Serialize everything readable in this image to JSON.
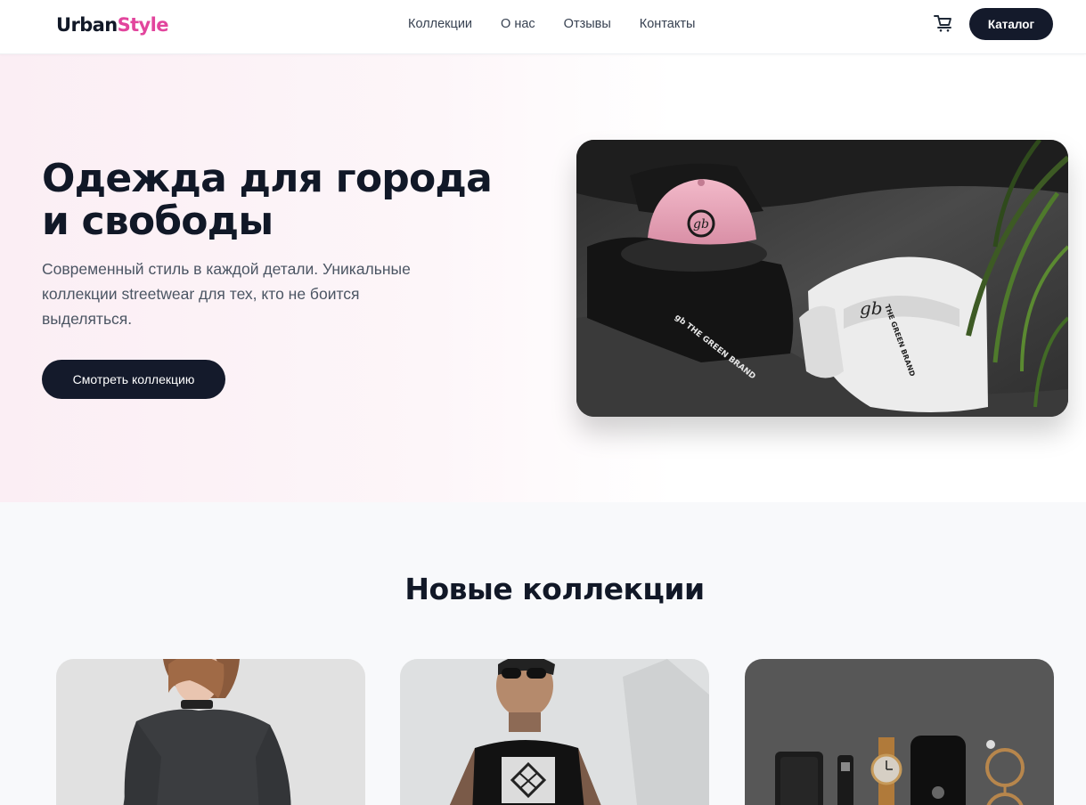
{
  "header": {
    "logo_part1": "Urban",
    "logo_part2": "Style",
    "nav": [
      "Коллекции",
      "О нас",
      "Отзывы",
      "Контакты"
    ],
    "cart_icon": "cart-icon",
    "catalog_label": "Каталог"
  },
  "hero": {
    "title_line1": "Одежда для города",
    "title_line2": "и свободы",
    "subtitle": "Современный стиль в каждой детали. Уникальные коллекции streetwear для тех, кто не боится выделяться.",
    "cta_label": "Смотреть коллекцию",
    "image_caption": "THE GREEN BRAND"
  },
  "collections": {
    "title": "Новые коллекции"
  },
  "colors": {
    "accent_pink": "#e2459d",
    "dark_button": "#141a2b",
    "hero_gradient_start": "#fbeef4",
    "section_bg": "#f8f9fb"
  }
}
